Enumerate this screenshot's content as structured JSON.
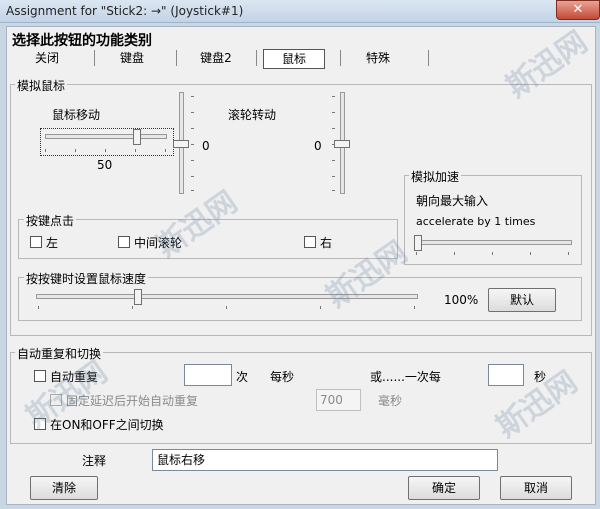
{
  "window": {
    "title": "Assignment for \"Stick2: →\" (Joystick#1)",
    "close_glyph": "✕"
  },
  "heading": "选择此按钮的功能类别",
  "tabs": [
    "关闭",
    "键盘",
    "键盘2",
    "鼠标",
    "特殊"
  ],
  "selected_tab": "鼠标",
  "mouse_group": {
    "label": "模拟鼠标",
    "mouse_move_label": "鼠标移动",
    "mouse_move_value": "50",
    "vertical_value": "0",
    "wheel_label": "滚轮转动",
    "wheel_value": "0"
  },
  "accel_group": {
    "label": "模拟加速",
    "max_input_label": "朝向最大输入",
    "accel_text": "accelerate by 1 times"
  },
  "click_group": {
    "label": "按键点击",
    "left": "左",
    "middle": "中间滚轮",
    "right": "右"
  },
  "speed_group": {
    "label": "按按键时设置鼠标速度",
    "percent": "100%",
    "default_button": "默认"
  },
  "repeat_group": {
    "label": "自动重复和切换",
    "auto_repeat": "自动重复",
    "times": "次",
    "per_second": "每秒",
    "or_once_every": "或......一次每",
    "seconds": "秒",
    "fixed_delay": "固定延迟后开始自动重复",
    "delay_value": "700",
    "ms": "毫秒",
    "toggle_on_off": "在ON和OFF之间切换"
  },
  "comment": {
    "label": "注释",
    "value": "鼠标右移"
  },
  "buttons": {
    "clear": "清除",
    "ok": "确定",
    "cancel": "取消"
  },
  "watermark": "斯迅网"
}
